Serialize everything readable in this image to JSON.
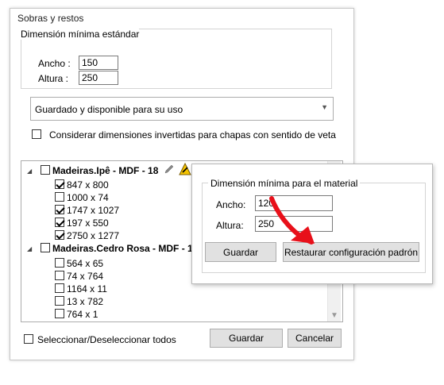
{
  "window": {
    "title": "Sobras y restos"
  },
  "standard": {
    "legend": "Dimensión mínima estándar",
    "width_label": "Ancho :",
    "width_value": "150",
    "height_label": "Altura :",
    "height_value": "250"
  },
  "combo": {
    "selected": "Guardado y disponible para su uso"
  },
  "inverted": {
    "label": "Considerar dimensiones invertidas para chapas con sentido de veta",
    "checked": false
  },
  "tree": {
    "nodes": [
      {
        "label": "Madeiras.Ipê - MDF - 18",
        "checked": false,
        "children": [
          {
            "label": "847 x 800",
            "checked": true
          },
          {
            "label": "1000 x 74",
            "checked": false
          },
          {
            "label": "1747 x 1027",
            "checked": true
          },
          {
            "label": "197 x 550",
            "checked": true
          },
          {
            "label": "2750 x 1277",
            "checked": true
          }
        ]
      },
      {
        "label": "Madeiras.Cedro Rosa - MDF - 1",
        "checked": false,
        "children": [
          {
            "label": "564 x 65",
            "checked": false
          },
          {
            "label": "74 x 764",
            "checked": false
          },
          {
            "label": "1164 x 11",
            "checked": false
          },
          {
            "label": "13 x 782",
            "checked": false
          },
          {
            "label": "764 x 1",
            "checked": false
          }
        ]
      }
    ]
  },
  "footer": {
    "select_all_label": "Seleccionar/Deseleccionar todos",
    "save_label": "Guardar",
    "cancel_label": "Cancelar"
  },
  "popup": {
    "legend": "Dimensión mínima para el material",
    "width_label": "Ancho:",
    "width_value": "120",
    "height_label": "Altura:",
    "height_value": "250",
    "save_label": "Guardar",
    "restore_label": "Restaurar configuración padrón"
  },
  "colors": {
    "annotation_arrow": "#e8101a",
    "warning_fill": "#f5c400"
  }
}
